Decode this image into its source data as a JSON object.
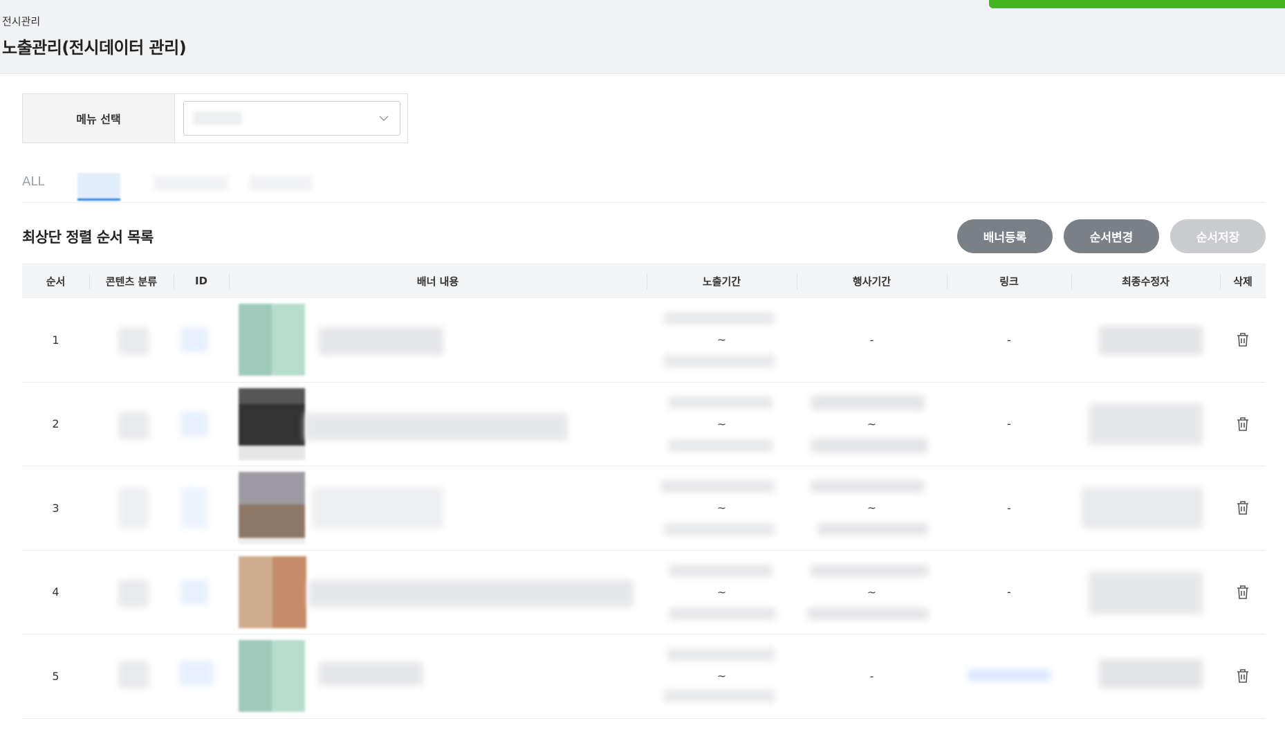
{
  "header": {
    "breadcrumb": "전시관리",
    "title": "노출관리(전시데이터 관리)"
  },
  "filter": {
    "label": "메뉴 선택",
    "icon": "chevron-down-icon"
  },
  "tabs": {
    "all_label": "ALL"
  },
  "section": {
    "title": "최상단 정렬 순서 목록"
  },
  "buttons": {
    "register": "배너등록",
    "reorder": "순서변경",
    "save_order": "순서저장"
  },
  "table": {
    "headers": {
      "order": "순서",
      "category": "콘텐츠 분류",
      "id": "ID",
      "banner": "배너 내용",
      "exposure": "노출기간",
      "event": "행사기간",
      "link": "링크",
      "modifier": "최종수정자",
      "delete": "삭제"
    },
    "rows": [
      {
        "order": "1",
        "exposure_sep": "~",
        "event": "-",
        "link": "-"
      },
      {
        "order": "2",
        "exposure_sep": "~",
        "event_sep": "~",
        "link": "-"
      },
      {
        "order": "3",
        "exposure_sep": "~",
        "event_sep": "~",
        "link": "-"
      },
      {
        "order": "4",
        "exposure_sep": "~",
        "event_sep": "~",
        "link": "-"
      },
      {
        "order": "5",
        "exposure_sep": "~",
        "event": "-"
      }
    ]
  },
  "colors": {
    "accent_green": "#43b51f",
    "button_dark": "#7b8087",
    "button_disabled": "#c9cbcf",
    "tab_active": "#2a7de1"
  }
}
